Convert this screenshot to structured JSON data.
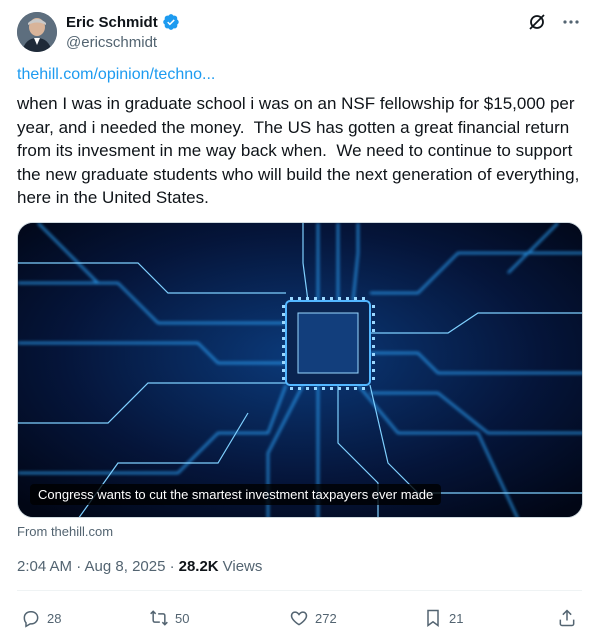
{
  "author": {
    "display_name": "Eric Schmidt",
    "handle": "@ericschmidt",
    "verified": true,
    "verified_color": "#1d9bf0"
  },
  "header_icons": [
    "grok-icon",
    "more-icon"
  ],
  "tweet": {
    "link_text": "thehill.com/opinion/techno...",
    "text": "when I was in graduate school i was on an NSF fellowship for $15,000 per year, and i needed the money.  The US has gotten a great financial return from its invesment in me way back when.  We need to continue to support the new graduate students who will build the next generation of everything, here in the United States."
  },
  "card": {
    "caption": "Congress wants to cut the smartest investment taxpayers ever made",
    "source": "From thehill.com",
    "image_subject": "blue circuit board with central microchip"
  },
  "meta": {
    "timestamp": "2:04 AM · Aug 8, 2025 · ",
    "views_count": "28.2K",
    "views_label": "Views"
  },
  "actions": {
    "replies": "28",
    "reposts": "50",
    "likes": "272",
    "bookmarks": "21"
  },
  "colors": {
    "accent": "#1d9bf0",
    "text_primary": "#0f1419",
    "text_secondary": "#536471",
    "circuit_glow": "#2fa8ff"
  }
}
